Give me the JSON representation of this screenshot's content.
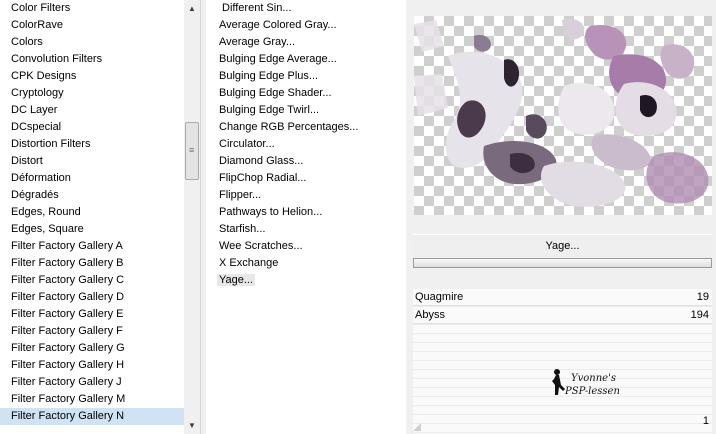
{
  "categories": {
    "items": [
      "Color Filters",
      "ColorRave",
      "Colors",
      "Convolution Filters",
      "CPK Designs",
      "Cryptology",
      "DC Layer",
      "DCspecial",
      "Distortion Filters",
      "Distort",
      "Déformation",
      "Dégradés",
      "Edges, Round",
      "Edges, Square",
      "Filter Factory Gallery A",
      "Filter Factory Gallery B",
      "Filter Factory Gallery C",
      "Filter Factory Gallery D",
      "Filter Factory Gallery E",
      "Filter Factory Gallery F",
      "Filter Factory Gallery G",
      "Filter Factory Gallery H",
      "Filter Factory Gallery J",
      "Filter Factory Gallery M",
      "Filter Factory Gallery N"
    ],
    "selected": "Filter Factory Gallery N",
    "scroll_up_icon": "triangle-up-icon",
    "scroll_down_icon": "triangle-down-icon"
  },
  "filters": {
    "items": [
      "Different Sin...",
      "Average Colored Gray...",
      "Average Gray...",
      "Bulging Edge Average...",
      "Bulging Edge Plus...",
      "Bulging Edge Shader...",
      "Bulging Edge Twirl...",
      "Change RGB Percentages...",
      "Circulator...",
      "Diamond Glass...",
      "FlipChop Radial...",
      "Flipper...",
      "Pathways to Helion...",
      "Starfish...",
      "Wee Scratches...",
      "X Exchange",
      "Yage..."
    ],
    "selected": "Yage..."
  },
  "apply": {
    "label": "Yage..."
  },
  "params": [
    {
      "label": "Quagmire",
      "value": "19"
    },
    {
      "label": "Abyss",
      "value": "194"
    }
  ],
  "watermark": {
    "line1": "Yvonne's",
    "line2": "PSP-lessen"
  },
  "bottom_value": "1",
  "colors": {
    "selection": "#cfe3f5",
    "preview_mauve": "#9a7a9e",
    "preview_dark": "#3a2a3e"
  }
}
